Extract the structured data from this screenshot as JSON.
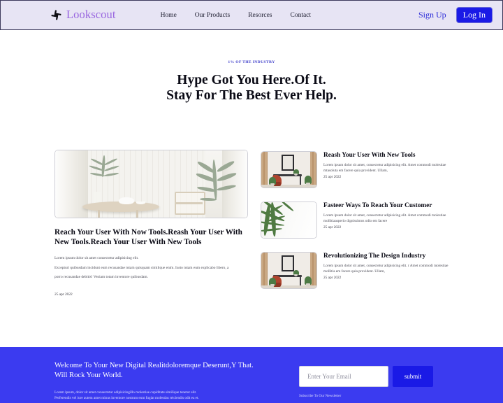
{
  "header": {
    "logo_icon": "pinwheel-hash-icon",
    "brand": "Lookscout",
    "nav": [
      {
        "label": "Home"
      },
      {
        "label": "Our Products"
      },
      {
        "label": "Resorces"
      },
      {
        "label": "Contact"
      }
    ],
    "signup_label": "Sign Up",
    "login_label": "Log In",
    "background_color": "#e7e4f4",
    "brand_color": "#9966e0",
    "accent_color": "#1a1ae6"
  },
  "hero": {
    "eyebrow": "1% OF THE INDUSTRY",
    "title_line1": "Hype Got You Here.Of It.",
    "title_line2": "Stay For The Best Ever Help.",
    "eyebrow_color": "#3b3bc9"
  },
  "feature": {
    "image_alt": "bright-interior-round-table-plants",
    "title": "Reach Your User With Now Tools.Reash Your User With New Tools.Reach Your User With New Tools",
    "body_line1": "Lorem ipsum dolor sit amet consectetur adipisicing elit.",
    "body_line2": "Excepturi quibusdam incidunt eum recusandae totam quisquam similique enim. Iusto totam eum explicabo libero, a",
    "body_line3": "porro recusandae debitis! Veniam totam inventore quibusdam.",
    "date": "25 apr 2022"
  },
  "cards": [
    {
      "image_alt": "living-room-framed-art-red-chair",
      "title": "Reash Your User With New Tools",
      "body": "Lorem ipsum dolor sit amet, consectetur adipisicing elit. Amet commodi molestiae mtasoluta em facere quia provident. Ullam,",
      "date": "25 apr 2022"
    },
    {
      "image_alt": "green-palm-leaves-white-wall",
      "title": "Fasteer Ways To Reach Your Customer",
      "body": "Lorem ipsum dolor sit amet, consectetur adipisicing elit. Amet commodi molestiae mollitiaasperio dignissimos odio em facere",
      "date": "25 apr 2022"
    },
    {
      "image_alt": "living-room-framed-art-red-chair",
      "title": "Revolutionizing The Design Industry",
      "body": "Lorem ipsum dolor sit amet, consectetur adipisicing elit. r Amet commodi molestiae mollitia em facere quia provident. Ullam,",
      "date": "25 apr 2022"
    }
  ],
  "footer": {
    "title_line1": "Welcome To Your New Digital Realitdoloremque Deserunt,Y That.",
    "title_line2": "Will Rock Your World.",
    "body_line1": "Lorem ipsum, dolor sit amet consectetur adipisicingillo molestiae cupiditate similique tenetur elit.",
    "body_line2": "Perferendis vel iure autem amet minus inventore nostrum eum fugiat molestias reiciendis odit ea et.",
    "email_placeholder": "Enter Your Email",
    "email_value": "",
    "submit_label": "submit",
    "newsletter_note": "Subscribe To Our Newsletter",
    "background_color": "#3b3bf0"
  }
}
